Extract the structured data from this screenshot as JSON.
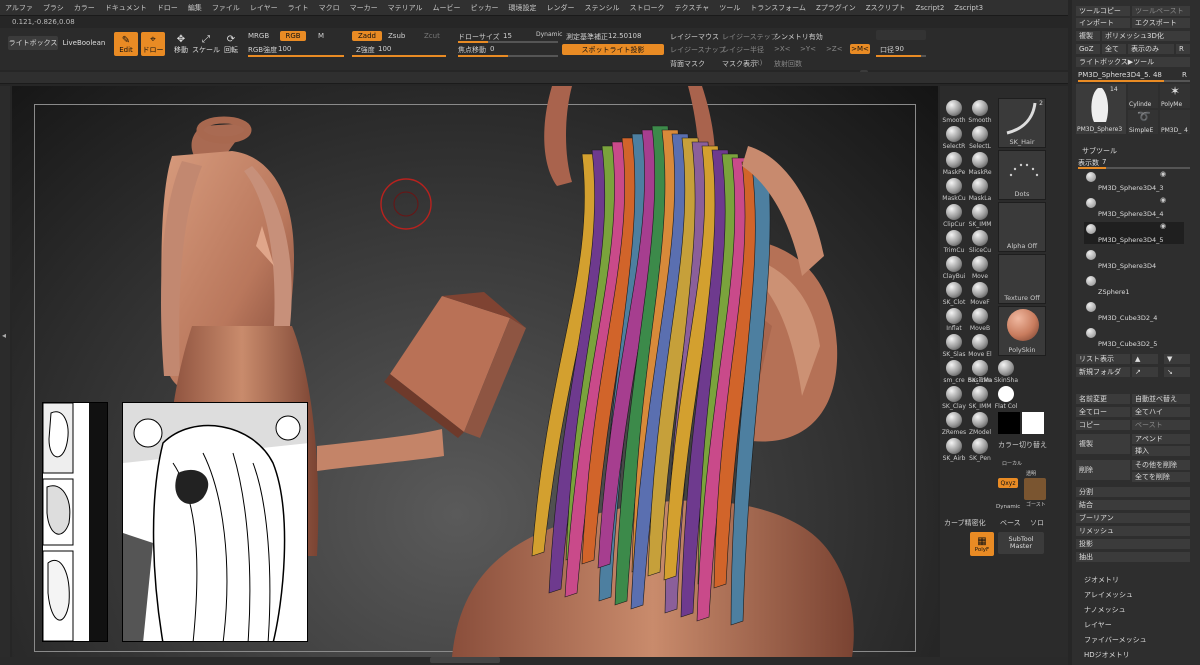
{
  "menu": [
    "アルファ",
    "ブラシ",
    "カラー",
    "ドキュメント",
    "ドロー",
    "編集",
    "ファイル",
    "レイヤー",
    "ライト",
    "マクロ",
    "マーカー",
    "マテリアル",
    "ムービー",
    "ピッカー",
    "環境設定",
    "レンダー",
    "ステンシル",
    "ストローク",
    "テクスチャ",
    "ツール",
    "トランスフォーム",
    "Zプラグイン",
    "Zスクリプト",
    "Zscript2",
    "Zscript3"
  ],
  "coords": "0.121,-0.826,0.08",
  "toolbar": {
    "lightbox": "ライトボックス",
    "liveboolean": "LiveBoolean",
    "edit": "Edit",
    "draw": "ドロー",
    "move": "移動",
    "scale": "スケール",
    "rotate": "回転",
    "mrgb": "MRGB",
    "rgb": "RGB",
    "m": "M",
    "rgb_intensity_label": "RGB強度",
    "rgb_intensity": "100",
    "zadd": "Zadd",
    "zsub": "Zsub",
    "zcut": "Zcut",
    "z_intensity_label": "Z強度",
    "z_intensity": "100",
    "draw_size_label": "ドローサイズ",
    "draw_size": "15",
    "dynamic": "Dynamic",
    "focal_label": "焦点移動",
    "focal": "0",
    "measure_label": "測定基準補正",
    "measure": "12.50108",
    "spotlight": "スポットライト投影",
    "lazymouse": "レイジーマウス",
    "lazystep": "レイジーステップ",
    "lazysnap": "レイジースナップ",
    "lazyradius": "レイジー半径",
    "backface": "背面マスク",
    "maskr": "マスク表示",
    "r_short": "(R)",
    "symmetry": "シンメトリ有効",
    "sym_x": ">X<",
    "sym_y": ">Y<",
    "sym_z": ">Z<",
    "sym_m": ">M<",
    "radial": "放射回数",
    "color": "カラー",
    "aperture_label": "口径",
    "aperture": "90"
  },
  "brushes": [
    {
      "name": "Smooth"
    },
    {
      "name": "Smooth"
    },
    {
      "name": "SelectR"
    },
    {
      "name": "SelectL"
    },
    {
      "name": "MaskPe"
    },
    {
      "name": "MaskRe"
    },
    {
      "name": "MaskCu"
    },
    {
      "name": "MaskLa"
    },
    {
      "name": "ClipCur"
    },
    {
      "name": "SK_IMM"
    },
    {
      "name": "TrimCu"
    },
    {
      "name": "SliceCu"
    },
    {
      "name": "ClayBui"
    },
    {
      "name": "Move"
    },
    {
      "name": "SK_Clot"
    },
    {
      "name": "MoveF"
    },
    {
      "name": "Inflat"
    },
    {
      "name": "MoveB"
    },
    {
      "name": "SK_Slas"
    },
    {
      "name": "Move El"
    },
    {
      "name": "sm_cre"
    },
    {
      "name": "SK_Trim"
    },
    {
      "name": "SK_Clay"
    },
    {
      "name": "SK_IMM"
    },
    {
      "name": "ZRemes"
    },
    {
      "name": "ZModel"
    },
    {
      "name": "SK_Airb"
    },
    {
      "name": "SK_Pen"
    }
  ],
  "brush_extra": {
    "basic_mat": "BasicMa",
    "skin_sh": "SkinSha",
    "flat_col": "Flat Col"
  },
  "preview": {
    "sk_hair": "SK_Hair",
    "dots": "Dots",
    "alpha_off": "Alpha Off",
    "texture_off": "Texture Off",
    "polyskin": "PolySkin",
    "color_switch": "カラー切り替え",
    "curve_refine": "カーブ精密化",
    "polyf": "PolyF",
    "subtool_master": "SubTool Master",
    "xyz": "Qxyz",
    "dynamic_small": "Dynamic",
    "transparent": "透明",
    "ghost": "ゴースト",
    "solo": "ソロ",
    "local": "ローカル",
    "base": "ベース",
    "count": "2"
  },
  "right_panel": {
    "tool_copy": "ツールコピー",
    "tool_paste": "ツールペースト",
    "import": "インポート",
    "export": "エクスポート",
    "clone": "複製",
    "poly3d": "ポリメッシュ3D化",
    "goz": "GoZ",
    "all": "全て",
    "show_only": "表示のみ",
    "r": "R",
    "lightbox_tool": "ライトボックス▶ツール",
    "current_tool": "PM3D_Sphere3D4_5. 48",
    "r2": "R",
    "thumb_count": "14",
    "thumbs": [
      "PM3D_Sphere3",
      "Cylinde",
      "PolyMe",
      "SimpleE",
      "PM3D_",
      "4"
    ],
    "subtool": "サブツール",
    "visible_label": "表示数",
    "visible": "7",
    "subtools": [
      "PM3D_Sphere3D4_3",
      "PM3D_Sphere3D4_4",
      "PM3D_Sphere3D4_5",
      "PM3D_Sphere3D4",
      "ZSphere1",
      "PM3D_Cube3D2_4",
      "PM3D_Cube3D2_5"
    ],
    "list_view": "リスト表示",
    "new_folder": "新規フォルダ",
    "rename": "名前変更",
    "auto_sort": "自動並べ替え",
    "all_low": "全てロー",
    "all_high": "全てハイ",
    "copy": "コピー",
    "paste": "ペースト",
    "duplicate": "複製",
    "append": "アペンド",
    "insert": "挿入",
    "delete": "削除",
    "delete_other": "その他を削除",
    "delete_all": "全てを削除",
    "split": "分割",
    "merge": "結合",
    "boolean": "ブーリアン",
    "remesh": "リメッシュ",
    "project": "投影",
    "extract": "抽出",
    "geometry": "ジオメトリ",
    "array_mesh": "アレイメッシュ",
    "nano_mesh": "ナノメッシュ",
    "layers": "レイヤー",
    "fibermesh": "ファイバーメッシュ",
    "hd_geometry": "HDジオメトリ"
  },
  "colors": {
    "accent": "#e98b24",
    "panel": "#2e2e2e",
    "skin": "#c48468"
  },
  "hair_strand_colors": [
    "#d3a02f",
    "#6e3a8e",
    "#7aa33c",
    "#c94a8a",
    "#d1642a",
    "#4d7fa0",
    "#a63e8f",
    "#3c8a4a",
    "#d88a3a",
    "#5a6fb0",
    "#c6a03a",
    "#8b5f9a"
  ]
}
